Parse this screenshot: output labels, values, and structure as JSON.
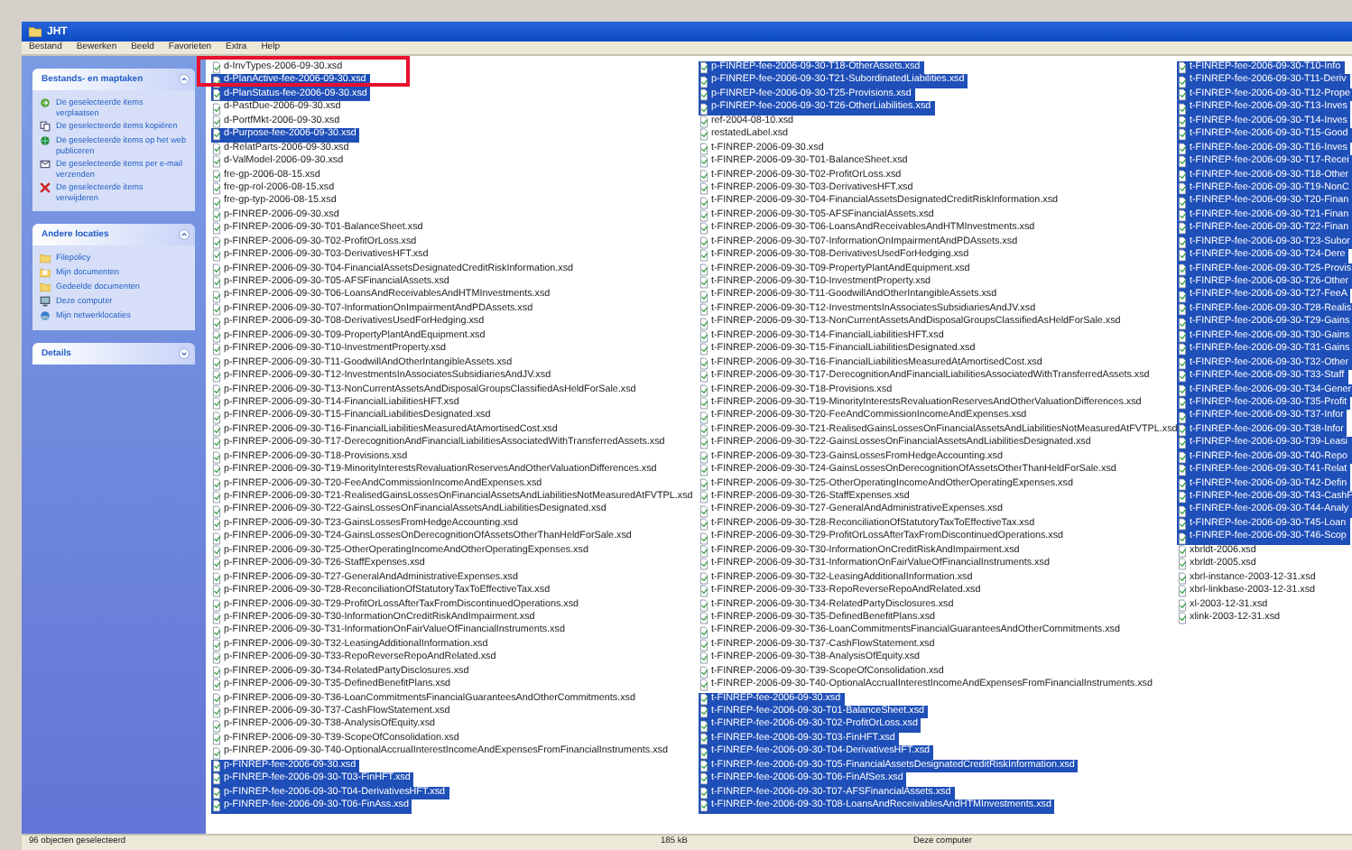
{
  "window": {
    "title": "JHT"
  },
  "menu": [
    "Bestand",
    "Bewerken",
    "Beeld",
    "Favorieten",
    "Extra",
    "Help"
  ],
  "sidebar": [
    {
      "title": "Bestands- en maptaken",
      "expanded": true,
      "items": [
        {
          "label": "De geselecteerde items verplaatsen",
          "kind": "move"
        },
        {
          "label": "De geselecteerde items kopiëren",
          "kind": "copy"
        },
        {
          "label": "De geselecteerde items op het web publiceren",
          "kind": "web"
        },
        {
          "label": "De geselecteerde items per e-mail verzenden",
          "kind": "mail"
        },
        {
          "label": "De geselecteerde items verwijderen",
          "kind": "delete"
        }
      ]
    },
    {
      "title": "Andere locaties",
      "expanded": true,
      "items": [
        {
          "label": "Filepolicy",
          "kind": "folder"
        },
        {
          "label": "Mijn documenten",
          "kind": "docs"
        },
        {
          "label": "Gedeelde documenten",
          "kind": "folder"
        },
        {
          "label": "Deze computer",
          "kind": "computer"
        },
        {
          "label": "Mijn netwerklocaties",
          "kind": "network"
        }
      ]
    },
    {
      "title": "Details",
      "expanded": false
    }
  ],
  "highlight": {
    "kind": "frame"
  },
  "columns": [
    [
      {
        "name": "d-InvTypes-2006-09-30.xsd",
        "selected": false
      },
      {
        "name": "d-PlanActive-fee-2006-09-30.xsd",
        "selected": true
      },
      {
        "name": "d-PlanStatus-fee-2006-09-30.xsd",
        "selected": true
      },
      {
        "name": "d-PastDue-2006-09-30.xsd",
        "selected": false
      },
      {
        "name": "d-PortfMkt-2006-09-30.xsd",
        "selected": false
      },
      {
        "name": "d-Purpose-fee-2006-09-30.xsd",
        "selected": true
      },
      {
        "name": "d-RelatParts-2006-09-30.xsd",
        "selected": false
      },
      {
        "name": "d-ValModel-2006-09-30.xsd",
        "selected": false
      },
      {
        "name": "fre-gp-2006-08-15.xsd",
        "selected": false
      },
      {
        "name": "fre-gp-rol-2006-08-15.xsd",
        "selected": false
      },
      {
        "name": "fre-gp-typ-2006-08-15.xsd",
        "selected": false
      },
      {
        "name": "p-FINREP-2006-09-30.xsd",
        "selected": false
      },
      {
        "name": "p-FINREP-2006-09-30-T01-BalanceSheet.xsd",
        "selected": false
      },
      {
        "name": "p-FINREP-2006-09-30-T02-ProfitOrLoss.xsd",
        "selected": false
      },
      {
        "name": "p-FINREP-2006-09-30-T03-DerivativesHFT.xsd",
        "selected": false
      },
      {
        "name": "p-FINREP-2006-09-30-T04-FinancialAssetsDesignatedCreditRiskInformation.xsd",
        "selected": false
      },
      {
        "name": "p-FINREP-2006-09-30-T05-AFSFinancialAssets.xsd",
        "selected": false
      },
      {
        "name": "p-FINREP-2006-09-30-T06-LoansAndReceivablesAndHTMInvestments.xsd",
        "selected": false
      },
      {
        "name": "p-FINREP-2006-09-30-T07-InformationOnImpairmentAndPDAssets.xsd",
        "selected": false
      },
      {
        "name": "p-FINREP-2006-09-30-T08-DerivativesUsedForHedging.xsd",
        "selected": false
      },
      {
        "name": "p-FINREP-2006-09-30-T09-PropertyPlantAndEquipment.xsd",
        "selected": false
      },
      {
        "name": "p-FINREP-2006-09-30-T10-InvestmentProperty.xsd",
        "selected": false
      },
      {
        "name": "p-FINREP-2006-09-30-T11-GoodwillAndOtherIntangibleAssets.xsd",
        "selected": false
      },
      {
        "name": "p-FINREP-2006-09-30-T12-InvestmentsInAssociatesSubsidiariesAndJV.xsd",
        "selected": false
      },
      {
        "name": "p-FINREP-2006-09-30-T13-NonCurrentAssetsAndDisposalGroupsClassifiedAsHeldForSale.xsd",
        "selected": false
      },
      {
        "name": "p-FINREP-2006-09-30-T14-FinancialLiabilitiesHFT.xsd",
        "selected": false
      },
      {
        "name": "p-FINREP-2006-09-30-T15-FinancialLiabilitiesDesignated.xsd",
        "selected": false
      },
      {
        "name": "p-FINREP-2006-09-30-T16-FinancialLiabilitiesMeasuredAtAmortisedCost.xsd",
        "selected": false
      },
      {
        "name": "p-FINREP-2006-09-30-T17-DerecognitionAndFinancialLiabilitiesAssociatedWithTransferredAssets.xsd",
        "selected": false
      },
      {
        "name": "p-FINREP-2006-09-30-T18-Provisions.xsd",
        "selected": false
      },
      {
        "name": "p-FINREP-2006-09-30-T19-MinorityInterestsRevaluationReservesAndOtherValuationDifferences.xsd",
        "selected": false
      },
      {
        "name": "p-FINREP-2006-09-30-T20-FeeAndCommissionIncomeAndExpenses.xsd",
        "selected": false
      },
      {
        "name": "p-FINREP-2006-09-30-T21-RealisedGainsLossesOnFinancialAssetsAndLiabilitiesNotMeasuredAtFVTPL.xsd",
        "selected": false
      },
      {
        "name": "p-FINREP-2006-09-30-T22-GainsLossesOnFinancialAssetsAndLiabilitiesDesignated.xsd",
        "selected": false
      },
      {
        "name": "p-FINREP-2006-09-30-T23-GainsLossesFromHedgeAccounting.xsd",
        "selected": false
      },
      {
        "name": "p-FINREP-2006-09-30-T24-GainsLossesOnDerecognitionOfAssetsOtherThanHeldForSale.xsd",
        "selected": false
      },
      {
        "name": "p-FINREP-2006-09-30-T25-OtherOperatingIncomeAndOtherOperatingExpenses.xsd",
        "selected": false
      },
      {
        "name": "p-FINREP-2006-09-30-T26-StaffExpenses.xsd",
        "selected": false
      },
      {
        "name": "p-FINREP-2006-09-30-T27-GeneralAndAdministrativeExpenses.xsd",
        "selected": false
      },
      {
        "name": "p-FINREP-2006-09-30-T28-ReconciliationOfStatutoryTaxToEffectiveTax.xsd",
        "selected": false
      },
      {
        "name": "p-FINREP-2006-09-30-T29-ProfitOrLossAfterTaxFromDiscontinuedOperations.xsd",
        "selected": false
      },
      {
        "name": "p-FINREP-2006-09-30-T30-InformationOnCreditRiskAndImpairment.xsd",
        "selected": false
      },
      {
        "name": "p-FINREP-2006-09-30-T31-InformationOnFairValueOfFinancialInstruments.xsd",
        "selected": false
      },
      {
        "name": "p-FINREP-2006-09-30-T32-LeasingAdditionalInformation.xsd",
        "selected": false
      },
      {
        "name": "p-FINREP-2006-09-30-T33-RepoReverseRepoAndRelated.xsd",
        "selected": false
      },
      {
        "name": "p-FINREP-2006-09-30-T34-RelatedPartyDisclosures.xsd",
        "selected": false
      },
      {
        "name": "p-FINREP-2006-09-30-T35-DefinedBenefitPlans.xsd",
        "selected": false
      },
      {
        "name": "p-FINREP-2006-09-30-T36-LoanCommitmentsFinancialGuaranteesAndOtherCommitments.xsd",
        "selected": false
      },
      {
        "name": "p-FINREP-2006-09-30-T37-CashFlowStatement.xsd",
        "selected": false
      },
      {
        "name": "p-FINREP-2006-09-30-T38-AnalysisOfEquity.xsd",
        "selected": false
      },
      {
        "name": "p-FINREP-2006-09-30-T39-ScopeOfConsolidation.xsd",
        "selected": false
      },
      {
        "name": "p-FINREP-2006-09-30-T40-OptionalAccrualInterestIncomeAndExpensesFromFinancialInstruments.xsd",
        "selected": false
      },
      {
        "name": "p-FINREP-fee-2006-09-30.xsd",
        "selected": true
      },
      {
        "name": "p-FINREP-fee-2006-09-30-T03-FinHFT.xsd",
        "selected": true
      },
      {
        "name": "p-FINREP-fee-2006-09-30-T04-DerivativesHFT.xsd",
        "selected": true
      },
      {
        "name": "p-FINREP-fee-2006-09-30-T06-FinAss.xsd",
        "selected": true
      }
    ],
    [
      {
        "name": "p-FINREP-fee-2006-09-30-T18-OtherAssets.xsd",
        "selected": true
      },
      {
        "name": "p-FINREP-fee-2006-09-30-T21-SubordinatedLiabilities.xsd",
        "selected": true
      },
      {
        "name": "p-FINREP-fee-2006-09-30-T25-Provisions.xsd",
        "selected": true
      },
      {
        "name": "p-FINREP-fee-2006-09-30-T26-OtherLiabilities.xsd",
        "selected": true
      },
      {
        "name": "ref-2004-08-10.xsd",
        "selected": false
      },
      {
        "name": "restatedLabel.xsd",
        "selected": false
      },
      {
        "name": "t-FINREP-2006-09-30.xsd",
        "selected": false
      },
      {
        "name": "t-FINREP-2006-09-30-T01-BalanceSheet.xsd",
        "selected": false
      },
      {
        "name": "t-FINREP-2006-09-30-T02-ProfitOrLoss.xsd",
        "selected": false
      },
      {
        "name": "t-FINREP-2006-09-30-T03-DerivativesHFT.xsd",
        "selected": false
      },
      {
        "name": "t-FINREP-2006-09-30-T04-FinancialAssetsDesignatedCreditRiskInformation.xsd",
        "selected": false
      },
      {
        "name": "t-FINREP-2006-09-30-T05-AFSFinancialAssets.xsd",
        "selected": false
      },
      {
        "name": "t-FINREP-2006-09-30-T06-LoansAndReceivablesAndHTMInvestments.xsd",
        "selected": false
      },
      {
        "name": "t-FINREP-2006-09-30-T07-InformationOnImpairmentAndPDAssets.xsd",
        "selected": false
      },
      {
        "name": "t-FINREP-2006-09-30-T08-DerivativesUsedForHedging.xsd",
        "selected": false
      },
      {
        "name": "t-FINREP-2006-09-30-T09-PropertyPlantAndEquipment.xsd",
        "selected": false
      },
      {
        "name": "t-FINREP-2006-09-30-T10-InvestmentProperty.xsd",
        "selected": false
      },
      {
        "name": "t-FINREP-2006-09-30-T11-GoodwillAndOtherIntangibleAssets.xsd",
        "selected": false
      },
      {
        "name": "t-FINREP-2006-09-30-T12-InvestmentsInAssociatesSubsidiariesAndJV.xsd",
        "selected": false
      },
      {
        "name": "t-FINREP-2006-09-30-T13-NonCurrentAssetsAndDisposalGroupsClassifiedAsHeldForSale.xsd",
        "selected": false
      },
      {
        "name": "t-FINREP-2006-09-30-T14-FinancialLiabilitiesHFT.xsd",
        "selected": false
      },
      {
        "name": "t-FINREP-2006-09-30-T15-FinancialLiabilitiesDesignated.xsd",
        "selected": false
      },
      {
        "name": "t-FINREP-2006-09-30-T16-FinancialLiabilitiesMeasuredAtAmortisedCost.xsd",
        "selected": false
      },
      {
        "name": "t-FINREP-2006-09-30-T17-DerecognitionAndFinancialLiabilitiesAssociatedWithTransferredAssets.xsd",
        "selected": false
      },
      {
        "name": "t-FINREP-2006-09-30-T18-Provisions.xsd",
        "selected": false
      },
      {
        "name": "t-FINREP-2006-09-30-T19-MinorityInterestsRevaluationReservesAndOtherValuationDifferences.xsd",
        "selected": false
      },
      {
        "name": "t-FINREP-2006-09-30-T20-FeeAndCommissionIncomeAndExpenses.xsd",
        "selected": false
      },
      {
        "name": "t-FINREP-2006-09-30-T21-RealisedGainsLossesOnFinancialAssetsAndLiabilitiesNotMeasuredAtFVTPL.xsd",
        "selected": false
      },
      {
        "name": "t-FINREP-2006-09-30-T22-GainsLossesOnFinancialAssetsAndLiabilitiesDesignated.xsd",
        "selected": false
      },
      {
        "name": "t-FINREP-2006-09-30-T23-GainsLossesFromHedgeAccounting.xsd",
        "selected": false
      },
      {
        "name": "t-FINREP-2006-09-30-T24-GainsLossesOnDerecognitionOfAssetsOtherThanHeldForSale.xsd",
        "selected": false
      },
      {
        "name": "t-FINREP-2006-09-30-T25-OtherOperatingIncomeAndOtherOperatingExpenses.xsd",
        "selected": false
      },
      {
        "name": "t-FINREP-2006-09-30-T26-StaffExpenses.xsd",
        "selected": false
      },
      {
        "name": "t-FINREP-2006-09-30-T27-GeneralAndAdministrativeExpenses.xsd",
        "selected": false
      },
      {
        "name": "t-FINREP-2006-09-30-T28-ReconciliationOfStatutoryTaxToEffectiveTax.xsd",
        "selected": false
      },
      {
        "name": "t-FINREP-2006-09-30-T29-ProfitOrLossAfterTaxFromDiscontinuedOperations.xsd",
        "selected": false
      },
      {
        "name": "t-FINREP-2006-09-30-T30-InformationOnCreditRiskAndImpairment.xsd",
        "selected": false
      },
      {
        "name": "t-FINREP-2006-09-30-T31-InformationOnFairValueOfFinancialInstruments.xsd",
        "selected": false
      },
      {
        "name": "t-FINREP-2006-09-30-T32-LeasingAdditionalInformation.xsd",
        "selected": false
      },
      {
        "name": "t-FINREP-2006-09-30-T33-RepoReverseRepoAndRelated.xsd",
        "selected": false
      },
      {
        "name": "t-FINREP-2006-09-30-T34-RelatedPartyDisclosures.xsd",
        "selected": false
      },
      {
        "name": "t-FINREP-2006-09-30-T35-DefinedBenefitPlans.xsd",
        "selected": false
      },
      {
        "name": "t-FINREP-2006-09-30-T36-LoanCommitmentsFinancialGuaranteesAndOtherCommitments.xsd",
        "selected": false
      },
      {
        "name": "t-FINREP-2006-09-30-T37-CashFlowStatement.xsd",
        "selected": false
      },
      {
        "name": "t-FINREP-2006-09-30-T38-AnalysisOfEquity.xsd",
        "selected": false
      },
      {
        "name": "t-FINREP-2006-09-30-T39-ScopeOfConsolidation.xsd",
        "selected": false
      },
      {
        "name": "t-FINREP-2006-09-30-T40-OptionalAccrualInterestIncomeAndExpensesFromFinancialInstruments.xsd",
        "selected": false
      },
      {
        "name": "t-FINREP-fee-2006-09-30.xsd",
        "selected": true
      },
      {
        "name": "t-FINREP-fee-2006-09-30-T01-BalanceSheet.xsd",
        "selected": true
      },
      {
        "name": "t-FINREP-fee-2006-09-30-T02-ProfitOrLoss.xsd",
        "selected": true
      },
      {
        "name": "t-FINREP-fee-2006-09-30-T03-FinHFT.xsd",
        "selected": true
      },
      {
        "name": "t-FINREP-fee-2006-09-30-T04-DerivativesHFT.xsd",
        "selected": true
      },
      {
        "name": "t-FINREP-fee-2006-09-30-T05-FinancialAssetsDesignatedCreditRiskInformation.xsd",
        "selected": true
      },
      {
        "name": "t-FINREP-fee-2006-09-30-T06-FinAfSes.xsd",
        "selected": true
      },
      {
        "name": "t-FINREP-fee-2006-09-30-T07-AFSFinancialAssets.xsd",
        "selected": true
      },
      {
        "name": "t-FINREP-fee-2006-09-30-T08-LoansAndReceivablesAndHTMInvestments.xsd",
        "selected": true
      }
    ],
    [
      {
        "name": "t-FINREP-fee-2006-09-30-T10-Info",
        "selected": true
      },
      {
        "name": "t-FINREP-fee-2006-09-30-T11-Deriv",
        "selected": true
      },
      {
        "name": "t-FINREP-fee-2006-09-30-T12-Prope",
        "selected": true
      },
      {
        "name": "t-FINREP-fee-2006-09-30-T13-Inves",
        "selected": true
      },
      {
        "name": "t-FINREP-fee-2006-09-30-T14-Inves",
        "selected": true
      },
      {
        "name": "t-FINREP-fee-2006-09-30-T15-Good",
        "selected": true
      },
      {
        "name": "t-FINREP-fee-2006-09-30-T16-Inves",
        "selected": true
      },
      {
        "name": "t-FINREP-fee-2006-09-30-T17-Recei",
        "selected": true
      },
      {
        "name": "t-FINREP-fee-2006-09-30-T18-Other",
        "selected": true
      },
      {
        "name": "t-FINREP-fee-2006-09-30-T19-NonC",
        "selected": true
      },
      {
        "name": "t-FINREP-fee-2006-09-30-T20-Finan",
        "selected": true
      },
      {
        "name": "t-FINREP-fee-2006-09-30-T21-Finan",
        "selected": true
      },
      {
        "name": "t-FINREP-fee-2006-09-30-T22-Finan",
        "selected": true
      },
      {
        "name": "t-FINREP-fee-2006-09-30-T23-Subor",
        "selected": true
      },
      {
        "name": "t-FINREP-fee-2006-09-30-T24-Dere",
        "selected": true
      },
      {
        "name": "t-FINREP-fee-2006-09-30-T25-Provis",
        "selected": true
      },
      {
        "name": "t-FINREP-fee-2006-09-30-T26-Other",
        "selected": true
      },
      {
        "name": "t-FINREP-fee-2006-09-30-T27-FeeA",
        "selected": true
      },
      {
        "name": "t-FINREP-fee-2006-09-30-T28-Realis",
        "selected": true
      },
      {
        "name": "t-FINREP-fee-2006-09-30-T29-Gains",
        "selected": true
      },
      {
        "name": "t-FINREP-fee-2006-09-30-T30-Gains",
        "selected": true
      },
      {
        "name": "t-FINREP-fee-2006-09-30-T31-Gains",
        "selected": true
      },
      {
        "name": "t-FINREP-fee-2006-09-30-T32-Other",
        "selected": true
      },
      {
        "name": "t-FINREP-fee-2006-09-30-T33-Staff",
        "selected": true
      },
      {
        "name": "t-FINREP-fee-2006-09-30-T34-Gener",
        "selected": true
      },
      {
        "name": "t-FINREP-fee-2006-09-30-T35-Profit",
        "selected": true
      },
      {
        "name": "t-FINREP-fee-2006-09-30-T37-Infor",
        "selected": true
      },
      {
        "name": "t-FINREP-fee-2006-09-30-T38-Infor",
        "selected": true
      },
      {
        "name": "t-FINREP-fee-2006-09-30-T39-Leasi",
        "selected": true
      },
      {
        "name": "t-FINREP-fee-2006-09-30-T40-Repo",
        "selected": true
      },
      {
        "name": "t-FINREP-fee-2006-09-30-T41-Relat",
        "selected": true
      },
      {
        "name": "t-FINREP-fee-2006-09-30-T42-Defin",
        "selected": true
      },
      {
        "name": "t-FINREP-fee-2006-09-30-T43-CashF",
        "selected": true
      },
      {
        "name": "t-FINREP-fee-2006-09-30-T44-Analy",
        "selected": true
      },
      {
        "name": "t-FINREP-fee-2006-09-30-T45-Loan",
        "selected": true
      },
      {
        "name": "t-FINREP-fee-2006-09-30-T46-Scop",
        "selected": true
      },
      {
        "name": "xbrldt-2006.xsd",
        "selected": false
      },
      {
        "name": "xbrldt-2005.xsd",
        "selected": false
      },
      {
        "name": "xbrl-instance-2003-12-31.xsd",
        "selected": false
      },
      {
        "name": "xbrl-linkbase-2003-12-31.xsd",
        "selected": false
      },
      {
        "name": "xl-2003-12-31.xsd",
        "selected": false
      },
      {
        "name": "xlink-2003-12-31.xsd",
        "selected": false
      }
    ]
  ],
  "status_bar": {
    "left": "96 objecten geselecteerd",
    "middle": "185 kB",
    "right": "Deze computer"
  }
}
